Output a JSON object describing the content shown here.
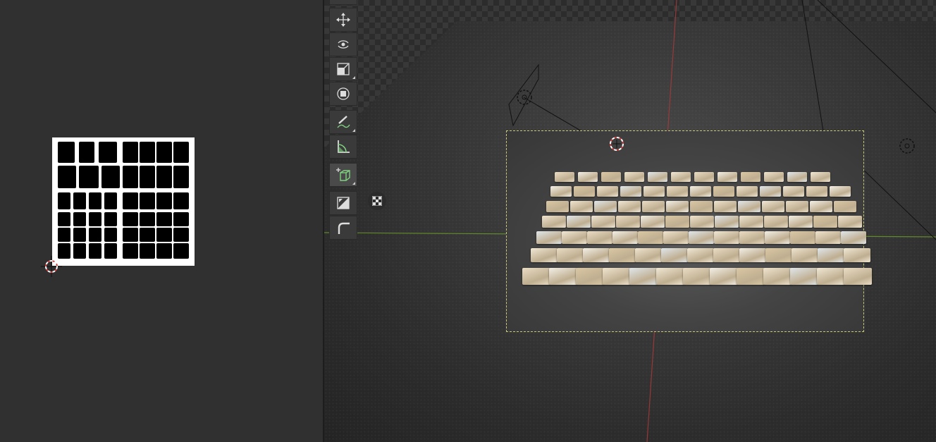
{
  "left_panel": {
    "name": "image-editor",
    "image_content": "binary-mask",
    "icons": [
      "2d-cursor-icon"
    ]
  },
  "viewport": {
    "name": "3d-viewport",
    "background": "checkerboard",
    "icons": [
      "3d-cursor-icon",
      "camera-icon",
      "light-icon"
    ]
  },
  "toolbar": {
    "tools": [
      {
        "name": "move-tool",
        "icon": "move-icon",
        "active": false,
        "has_menu": false
      },
      {
        "name": "rotate-tool",
        "icon": "rotate-icon",
        "active": false,
        "has_menu": false
      },
      {
        "name": "scale-tool",
        "icon": "scale-icon",
        "active": false,
        "has_menu": true
      },
      {
        "name": "transform-tool",
        "icon": "transform-icon",
        "active": false,
        "has_menu": false
      },
      {
        "name": "annotate-tool",
        "icon": "annotate-icon",
        "active": false,
        "has_menu": true
      },
      {
        "name": "measure-tool",
        "icon": "measure-icon",
        "active": false,
        "has_menu": false
      },
      {
        "name": "add-cube-tool",
        "icon": "add-cube-icon",
        "active": true,
        "has_menu": true
      },
      {
        "name": "shade-tool",
        "icon": "shade-icon",
        "active": false,
        "has_menu": false
      },
      {
        "name": "bevel-tool",
        "icon": "bevel-icon",
        "active": false,
        "has_menu": false
      }
    ]
  },
  "colors": {
    "panel_bg": "#303030",
    "button_bg": "#3a3a3a",
    "x_axis": "#a83a3a",
    "y_axis": "#6a9a2a",
    "selection_outline": "#c9c97a",
    "cursor_red": "#d04040",
    "accent_green": "#7fd17f"
  }
}
